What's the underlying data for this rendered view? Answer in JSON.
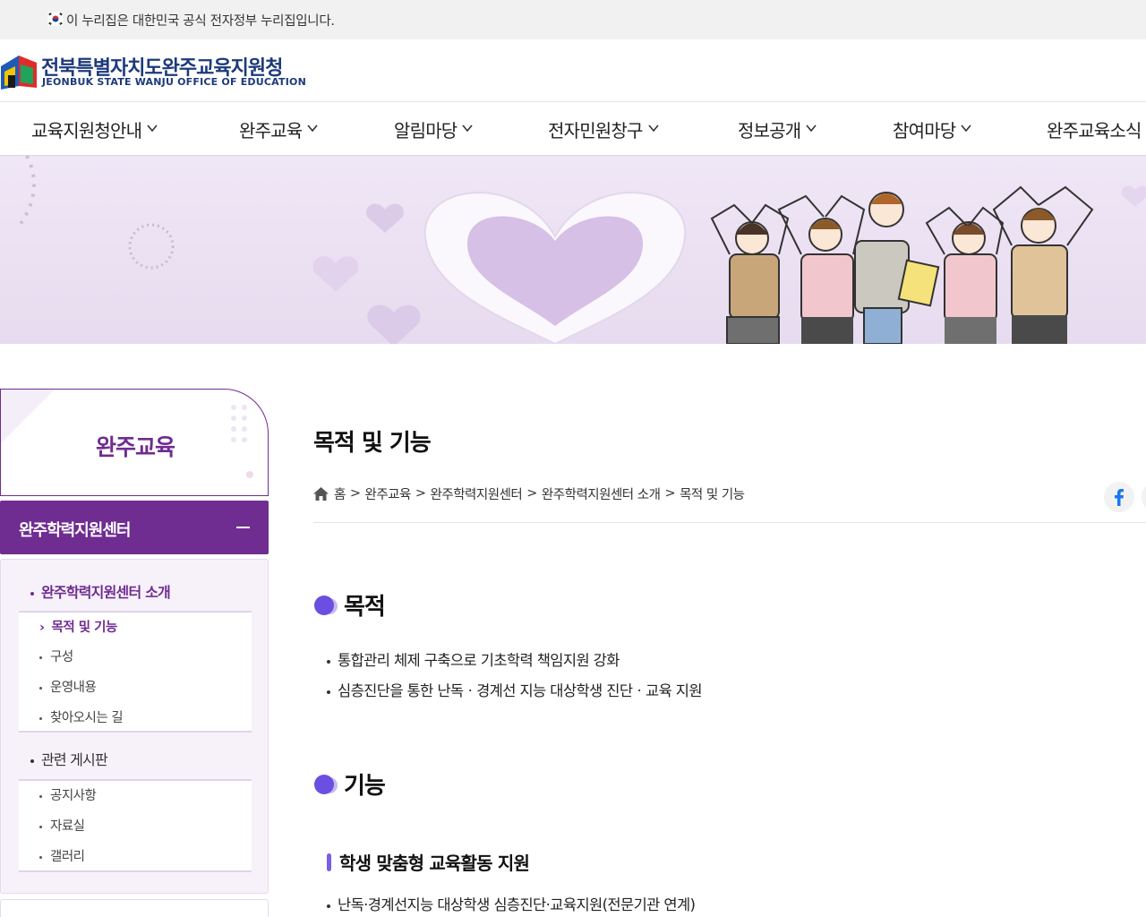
{
  "gov_banner": {
    "text": "이 누리집은 대한민국 공식 전자정부 누리집입니다."
  },
  "logo": {
    "korean": "전북특별자치도완주교육지원청",
    "english": "JEONBUK STATE WANJU OFFICE OF EDUCATION"
  },
  "gnb": {
    "items": [
      "교육지원청안내",
      "완주교육",
      "알림마당",
      "전자민원창구",
      "정보공개",
      "참여마당",
      "완주교육소식"
    ]
  },
  "lnb": {
    "title": "완주교육",
    "category": "완주학력지원센터",
    "groups": [
      {
        "label": "완주학력지원센터 소개",
        "items": [
          "목적 및 기능",
          "구성",
          "운영내용",
          "찾아오시는 길"
        ]
      },
      {
        "label": "관련 게시판",
        "items": [
          "공지사항",
          "자료실",
          "갤러리"
        ]
      }
    ],
    "active_item": "목적 및 기능"
  },
  "content": {
    "title": "목적 및 기능",
    "breadcrumb": [
      "홈",
      "완주교육",
      "완주학력지원센터",
      "완주학력지원센터 소개",
      "목적 및 기능"
    ],
    "breadcrumb_sep": ">",
    "sections": [
      {
        "heading": "목적",
        "bullets": [
          "통합관리 체제 구축으로 기초학력 책임지원 강화",
          "심층진단을 통한 난독ㆍ경계선 지능 대상학생 진단ㆍ교육 지원"
        ]
      },
      {
        "heading": "기능",
        "subheading": "학생 맞춤형 교육활동 지원",
        "bullets": [
          "난독·경계선지능 대상학생 심층진단·교육지원(전문기관 연계)"
        ]
      }
    ]
  },
  "icons": [
    "korea-flag-icon",
    "home-icon",
    "facebook-icon",
    "chevron-down-icon",
    "minus-icon"
  ],
  "colors": {
    "brand_purple": "#6f2c91",
    "logo_blue": "#1d3a7a",
    "accent_ball": "#7b5fe0",
    "facebook": "#1877f2"
  }
}
